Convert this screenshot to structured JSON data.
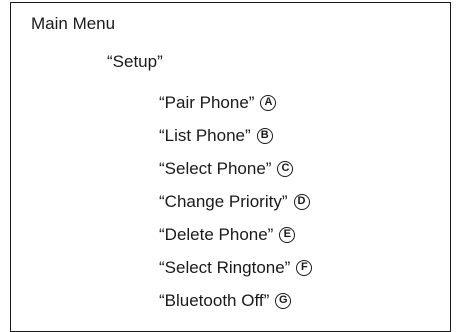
{
  "menu": {
    "title": "Main Menu",
    "submenu": "“Setup”",
    "items": [
      {
        "label": "“Pair Phone”",
        "callout": "A"
      },
      {
        "label": "“List Phone”",
        "callout": "B"
      },
      {
        "label": "“Select Phone”",
        "callout": "C"
      },
      {
        "label": "“Change Priority”",
        "callout": "D"
      },
      {
        "label": "“Delete Phone”",
        "callout": "E"
      },
      {
        "label": "“Select Ringtone”",
        "callout": "F"
      },
      {
        "label": "“Bluetooth Off”",
        "callout": "G"
      }
    ]
  }
}
